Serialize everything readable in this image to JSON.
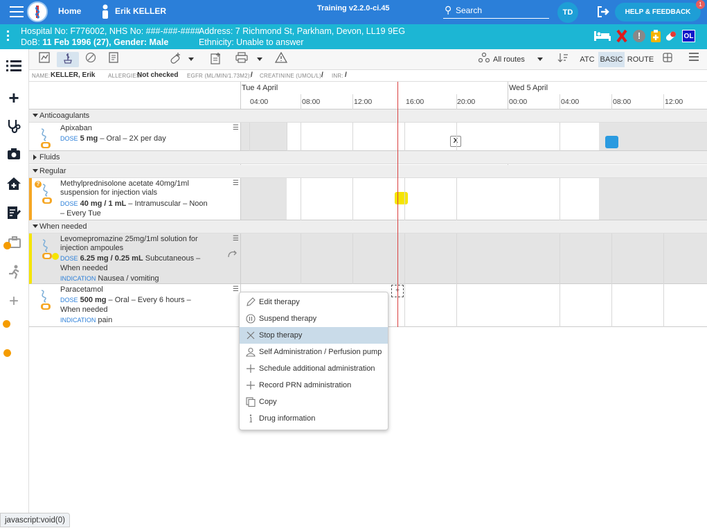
{
  "header": {
    "home_label": "Home",
    "patient_name": "Erik KELLER",
    "version": "Training v2.2.0-ci.45",
    "search_label": "Search",
    "user_initials": "TD",
    "help_label": "HELP & FEEDBACK",
    "help_badge": "1"
  },
  "patient": {
    "line1_left": "Hospital No: F776002, NHS No: ###-###-####",
    "line1_right": "Address: 7 Richmond St, Parkham, Devon, LL19 9EG",
    "line2_left_label": "DoB: ",
    "line2_left_value": "11 Feb 1996 (27), Gender: Male",
    "line2_right": "Ethnicity: Unable to answer",
    "badge_initials": "OL"
  },
  "toolbar": {
    "routes_label": "All routes",
    "atc_label": "ATC",
    "basic_label": "BASIC",
    "route_label": "ROUTE"
  },
  "namebar": {
    "name_label": "NAME:",
    "name_value": "KELLER, Erik",
    "allergies_label": "ALLERGIES:",
    "allergies_value": "Not checked",
    "egfr_label": "EGFR (ML/MIN/1.73M2):",
    "egfr_value": "/",
    "creatinine_label": "CREATININE (UMOL/L):",
    "creatinine_value": "/",
    "inr_label": "INR:",
    "inr_value": "/"
  },
  "timeline": {
    "dates": [
      "Tue 4 April",
      "Wed 5 April"
    ],
    "times": [
      "04:00",
      "08:00",
      "12:00",
      "16:00",
      "20:00",
      "00:00",
      "04:00",
      "08:00",
      "12:00"
    ]
  },
  "groups": {
    "anticoagulants": "Anticoagulants",
    "fluids": "Fluids",
    "regular": "Regular",
    "when_needed": "When needed"
  },
  "meds": [
    {
      "name": "Apixaban",
      "dose_label": "DOSE",
      "dose_value": "5 mg",
      "dose_rest": " – Oral – 2X per day",
      "indication_label": "",
      "indication": ""
    },
    {
      "name": "Methylprednisolone acetate 40mg/1ml suspension for injection vials",
      "dose_label": "DOSE",
      "dose_value": "40 mg / 1 mL",
      "dose_rest": " – Intramuscular – Noon – Every Tue",
      "indication_label": "",
      "indication": ""
    },
    {
      "name": "Levomepromazine 25mg/1ml solution for injection ampoules",
      "dose_label": "DOSE",
      "dose_value": "6.25 mg / 0.25 mL",
      "dose_rest": " Subcutaneous – When needed",
      "indication_label": "INDICATION",
      "indication": "Nausea / vomiting"
    },
    {
      "name": "Paracetamol",
      "dose_label": "DOSE",
      "dose_value": "500 mg",
      "dose_rest": " – Oral – Every 6 hours – When needed",
      "indication_label": "INDICATION",
      "indication": "pain"
    }
  ],
  "admin_marks": {
    "missed_symbol": "X",
    "add_symbol": "+"
  },
  "context_menu": [
    {
      "label": "Edit therapy",
      "icon": "pencil-icon"
    },
    {
      "label": "Suspend therapy",
      "icon": "pause-icon"
    },
    {
      "label": "Stop therapy",
      "icon": "x-icon"
    },
    {
      "label": "Self Administration / Perfusion pump",
      "icon": "person-icon"
    },
    {
      "label": "Schedule additional administration",
      "icon": "plus-icon"
    },
    {
      "label": "Record PRN administration",
      "icon": "plus-icon"
    },
    {
      "label": "Copy",
      "icon": "copy-icon"
    },
    {
      "label": "Drug information",
      "icon": "info-icon"
    }
  ],
  "statusbar": {
    "text": "javascript:void(0)"
  },
  "colors": {
    "topbar": "#2b7fd9",
    "patientbar": "#1cb6d4",
    "highlight_yellow": "#f5e400",
    "blue_admin": "#2b9be0",
    "now_line": "#d94040"
  }
}
